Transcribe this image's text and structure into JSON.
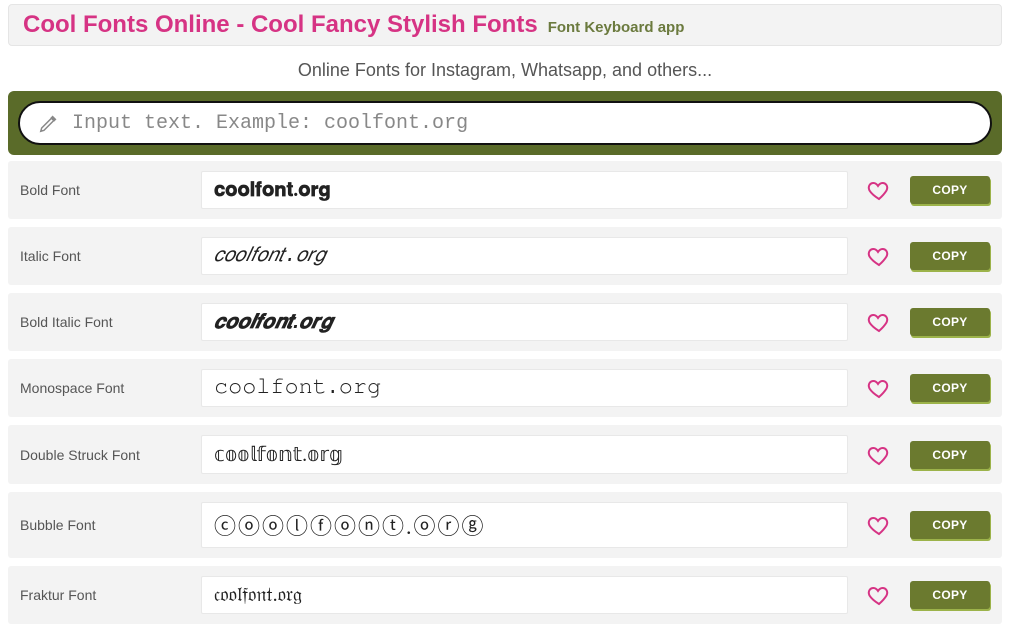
{
  "header": {
    "title": "Cool Fonts Online - Cool Fancy Stylish Fonts",
    "app_link": "Font Keyboard app"
  },
  "tagline": "Online Fonts for Instagram, Whatsapp, and others...",
  "input": {
    "placeholder": "Input text. Example: coolfont.org",
    "value": ""
  },
  "copy_label": "COPY",
  "fonts": [
    {
      "label": "Bold Font",
      "output": "𝐜𝐨𝐨𝐥𝐟𝐨𝐧𝐭.𝐨𝐫𝐠",
      "style": "f-bold"
    },
    {
      "label": "Italic Font",
      "output": "𝑐𝑜𝑜𝑙𝑓𝑜𝑛𝑡.𝑜𝑟𝑔",
      "style": "f-italic"
    },
    {
      "label": "Bold Italic Font",
      "output": "𝒄𝒐𝒐𝒍𝒇𝒐𝒏𝒕.𝒐𝒓𝒈",
      "style": "f-bolditalic"
    },
    {
      "label": "Monospace Font",
      "output": "𝚌𝚘𝚘𝚕𝚏𝚘𝚗𝚝.𝚘𝚛𝚐",
      "style": "f-mono"
    },
    {
      "label": "Double Struck Font",
      "output": "𝕔𝕠𝕠𝕝𝕗𝕠𝕟𝕥.𝕠𝕣𝕘",
      "style": "f-doublestruck"
    },
    {
      "label": "Bubble Font",
      "output": "ⓒⓞⓞⓛⓕⓞⓝⓣ.ⓞⓡⓖ",
      "style": "f-bubble"
    },
    {
      "label": "Fraktur Font",
      "output": "𝔠𝔬𝔬𝔩𝔣𝔬𝔫𝔱.𝔬𝔯𝔤",
      "style": "f-fraktur"
    }
  ]
}
